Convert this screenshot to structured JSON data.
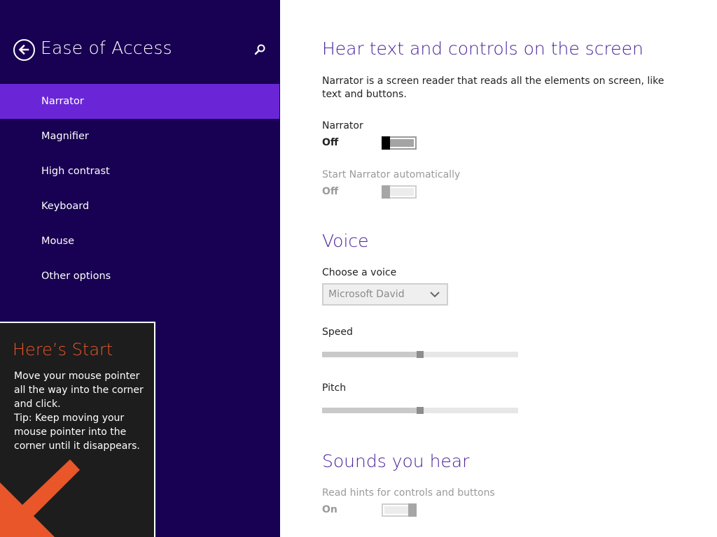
{
  "sidebar": {
    "title": "Ease of Access",
    "items": [
      {
        "label": "Narrator",
        "selected": true
      },
      {
        "label": "Magnifier",
        "selected": false
      },
      {
        "label": "High contrast",
        "selected": false
      },
      {
        "label": "Keyboard",
        "selected": false
      },
      {
        "label": "Mouse",
        "selected": false
      },
      {
        "label": "Other options",
        "selected": false
      }
    ]
  },
  "start_tip": {
    "title": "Here’s Start",
    "lines": [
      "Move your mouse pointer",
      "all the way into the corner",
      "and click.",
      "Tip: Keep moving your",
      "mouse pointer into the",
      "corner until it disappears."
    ]
  },
  "main": {
    "heading": "Hear text and controls on the screen",
    "description": "Narrator is a screen reader that reads all the elements on screen, like text and buttons.",
    "narrator": {
      "label": "Narrator",
      "state": "Off",
      "on": false,
      "enabled": true
    },
    "auto_start": {
      "label": "Start Narrator automatically",
      "state": "Off",
      "on": false,
      "enabled": false
    },
    "voice": {
      "heading": "Voice",
      "choose_label": "Choose a voice",
      "selected_voice": "Microsoft David",
      "speed_label": "Speed",
      "speed_value": 0.5,
      "pitch_label": "Pitch",
      "pitch_value": 0.5
    },
    "sounds": {
      "heading": "Sounds you hear",
      "hints": {
        "label": "Read hints for controls and buttons",
        "state": "On",
        "on": true,
        "enabled": false
      }
    }
  },
  "colors": {
    "sidebar_bg": "#180052",
    "selected_item": "#6a26d6",
    "heading": "#4a2498",
    "tip_title": "#e8562a",
    "tip_arrow": "#e8562a"
  },
  "icons": {
    "back": "back-arrow-circle-icon",
    "search": "search-icon",
    "dropdown": "chevron-down-icon",
    "tip_arrow": "arrow-down-left-icon"
  }
}
